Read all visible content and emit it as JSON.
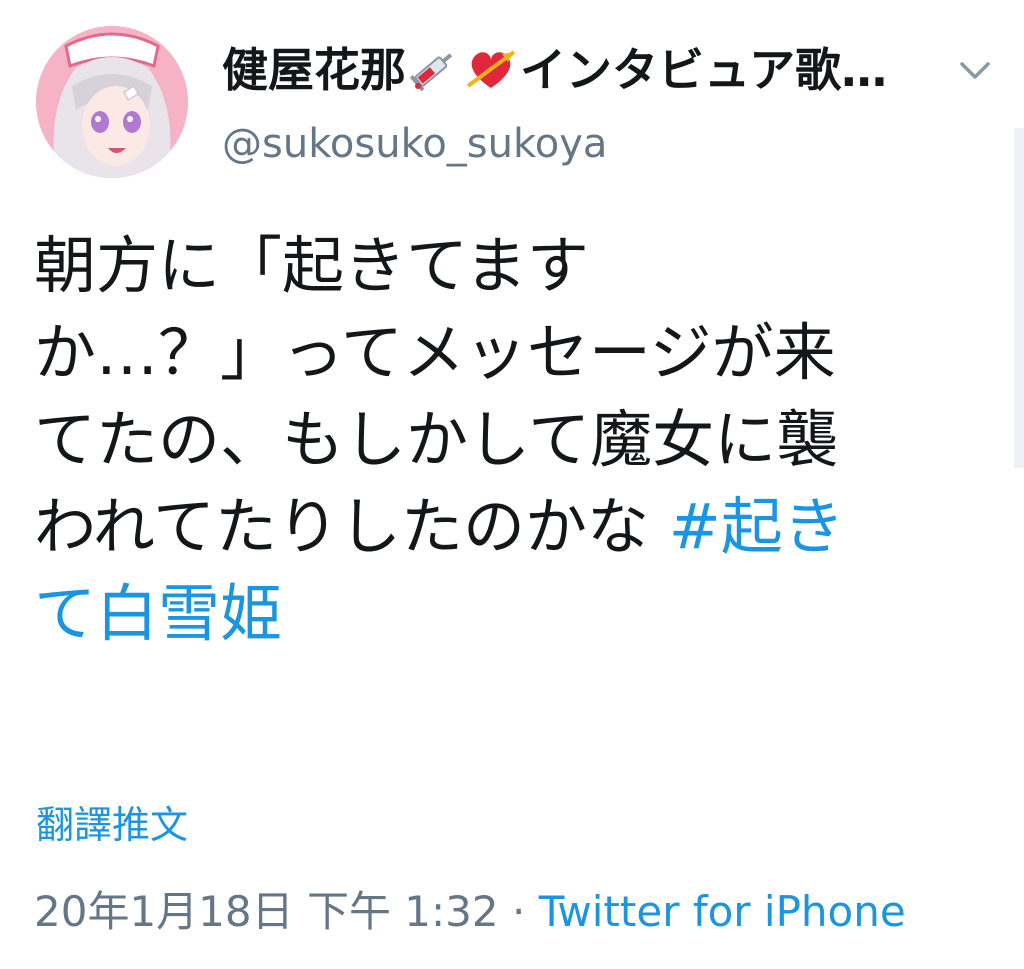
{
  "author": {
    "display_name": "健屋花那",
    "display_name_tail": "インタビュア歌…",
    "name_emojis": [
      "syringe-icon",
      "heart-with-arrow-icon"
    ],
    "handle": "@sukosuko_sukoya"
  },
  "tweet": {
    "lines": [
      "朝方に「起きてます",
      "か…？」ってメッセージが来",
      "てたの、もしかして魔女に襲",
      "われてたりしたのかな "
    ],
    "hashtag_part1": "#起き",
    "hashtag_part2": "て白雪姫"
  },
  "translate_label": "翻譯推文",
  "meta": {
    "timestamp": "20年1月18日 下午 1:32",
    "separator": " · ",
    "source": "Twitter for iPhone"
  },
  "colors": {
    "link": "#1b95e0",
    "text": "#14171a",
    "muted": "#657786"
  }
}
